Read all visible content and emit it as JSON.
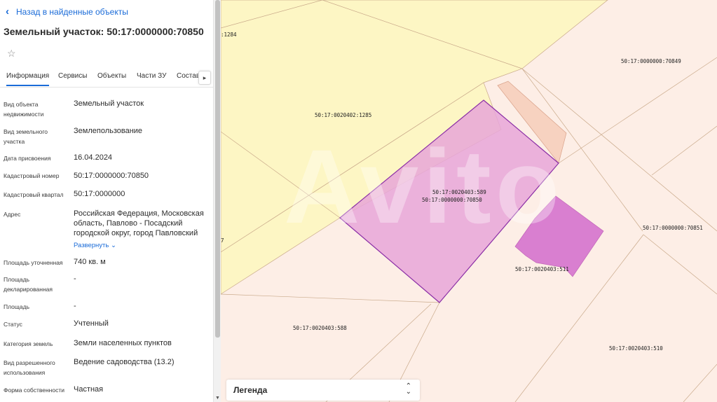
{
  "header": {
    "back_label": "Назад в найденные объекты",
    "title": "Земельный участок: 50:17:0000000:70850"
  },
  "tabs": [
    {
      "label": "Информация"
    },
    {
      "label": "Сервисы"
    },
    {
      "label": "Объекты"
    },
    {
      "label": "Части ЗУ"
    },
    {
      "label": "Состав"
    }
  ],
  "info": [
    {
      "label": "Вид объекта недвижимости",
      "value": "Земельный участок"
    },
    {
      "label": "Вид земельного участка",
      "value": "Землепользование"
    },
    {
      "label": "Дата присвоения",
      "value": "16.04.2024"
    },
    {
      "label": "Кадастровый номер",
      "value": "50:17:0000000:70850"
    },
    {
      "label": "Кадастровый квартал",
      "value": "50:17:0000000"
    },
    {
      "label": "Адрес",
      "value": "Российская Федерация, Московская область, Павлово - Посадский городской округ, город Павловский"
    },
    {
      "label": "Площадь уточненная",
      "value": "740 кв. м"
    },
    {
      "label": "Площадь декларированная",
      "value": "-"
    },
    {
      "label": "Площадь",
      "value": "-"
    },
    {
      "label": "Статус",
      "value": "Учтенный"
    },
    {
      "label": "Категория земель",
      "value": "Земли населенных пунктов"
    },
    {
      "label": "Вид разрешенного использования",
      "value": "Ведение садоводства (13.2)"
    },
    {
      "label": "Форма собственности",
      "value": "Частная"
    }
  ],
  "expand_label": "Развернуть",
  "map": {
    "labels": {
      "p1284": ":1284",
      "p70849": "50:17:0000000:70849",
      "p1285": "50:17:0020402:1285",
      "p589": "50:17:0020403:589",
      "p70850": "50:17:0000000:70850",
      "p70851": "50:17:0000000:70851",
      "p511": "50:17:0020403:511",
      "p588": "50:17:0020403:588",
      "p510": "50:17:0020403:510",
      "p7": "7"
    },
    "colors": {
      "yellow_parcel": "#fdf6c4",
      "pink_parcel": "#fdeee6",
      "selected_fill": "#e8a6d8",
      "selected_stroke": "#8b2fa6",
      "other_fill": "#d97fd0"
    },
    "watermark": "Avito"
  },
  "legend": {
    "label": "Легенда"
  }
}
